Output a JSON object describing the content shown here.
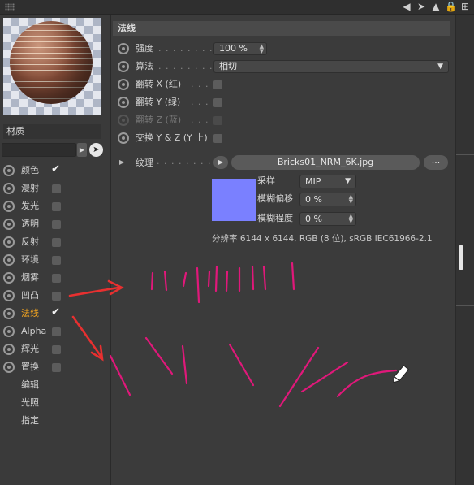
{
  "topbar": {
    "icons": [
      "back-arrow-icon",
      "cursor-icon",
      "up-arrow-icon",
      "lock-icon",
      "add-panel-icon"
    ]
  },
  "left": {
    "material_label": "材质",
    "search_value": "",
    "channels": [
      {
        "label": "颜色",
        "radio": true,
        "checked": true,
        "active": false
      },
      {
        "label": "漫射",
        "radio": true,
        "checked": false,
        "active": false
      },
      {
        "label": "发光",
        "radio": true,
        "checked": false,
        "active": false
      },
      {
        "label": "透明",
        "radio": true,
        "checked": false,
        "active": false
      },
      {
        "label": "反射",
        "radio": true,
        "checked": false,
        "active": false
      },
      {
        "label": "环境",
        "radio": true,
        "checked": false,
        "active": false
      },
      {
        "label": "烟雾",
        "radio": true,
        "checked": false,
        "active": false
      },
      {
        "label": "凹凸",
        "radio": true,
        "checked": false,
        "active": false
      },
      {
        "label": "法线",
        "radio": true,
        "checked": true,
        "active": true
      },
      {
        "label": "Alpha",
        "radio": true,
        "checked": false,
        "active": false
      },
      {
        "label": "辉光",
        "radio": true,
        "checked": false,
        "active": false
      },
      {
        "label": "置换",
        "radio": true,
        "checked": false,
        "active": false
      },
      {
        "label": "编辑",
        "radio": false,
        "checked": null,
        "active": false
      },
      {
        "label": "光照",
        "radio": false,
        "checked": null,
        "active": false
      },
      {
        "label": "指定",
        "radio": false,
        "checked": null,
        "active": false
      }
    ]
  },
  "section": {
    "title": "法线"
  },
  "params": {
    "strength_label": "强度",
    "strength_value": "100 %",
    "algorithm_label": "算法",
    "algorithm_value": "相切",
    "flip_x_label": "翻转 X (红)",
    "flip_y_label": "翻转 Y (绿)",
    "flip_z_label": "翻转 Z (蓝)",
    "swap_label": "交换 Y & Z (Y 上)"
  },
  "texture": {
    "label": "纹理",
    "filename": "Bricks01_NRM_6K.jpg",
    "more": "...",
    "swatch_color": "#7a80ff",
    "sampling_label": "采样",
    "sampling_value": "MIP",
    "blur_offset_label": "模糊偏移",
    "blur_offset_value": "0 %",
    "blur_scale_label": "模糊程度",
    "blur_scale_value": "0 %",
    "resolution": "分辨率 6144 x 6144, RGB (8 位), sRGB IEC61966-2.1"
  },
  "colors": {
    "active_channel": "#f0a320",
    "annotation": "#e0187a",
    "arrow": "#e83030"
  }
}
